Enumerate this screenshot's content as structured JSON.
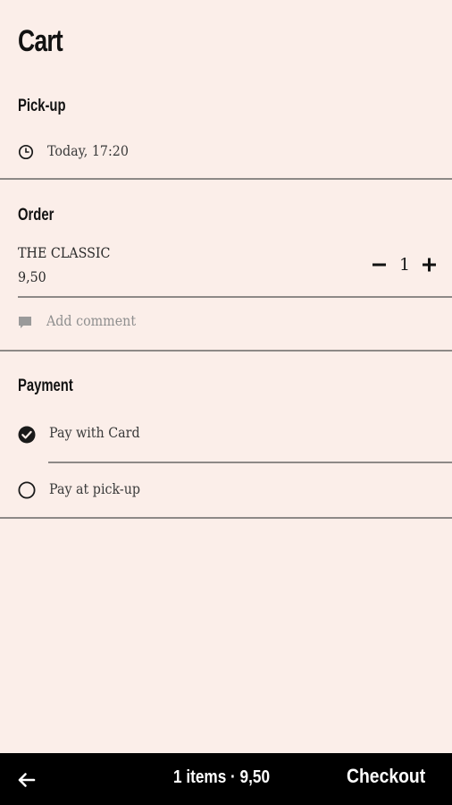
{
  "header": {
    "title": "Cart"
  },
  "pickup": {
    "heading": "Pick-up",
    "time": "Today, 17:20"
  },
  "order": {
    "heading": "Order",
    "items": [
      {
        "name": "THE CLASSIC",
        "price": "9,50",
        "quantity": "1"
      }
    ],
    "comment_placeholder": "Add comment"
  },
  "payment": {
    "heading": "Payment",
    "options": [
      {
        "label": "Pay with Card",
        "selected": true
      },
      {
        "label": "Pay at pick-up",
        "selected": false
      }
    ]
  },
  "footer": {
    "summary": "1 items · 9,50",
    "checkout_label": "Checkout"
  },
  "colors": {
    "background": "#fbeee9",
    "divider": "#8d8987",
    "bottom_bar": "#000000",
    "text": "#1a1a1a",
    "muted_text": "#3a3a3a"
  },
  "icons": {
    "pickup": "clock-icon",
    "comment": "comment-icon",
    "selected": "check-circle-icon",
    "unselected": "radio-empty-icon",
    "back": "arrow-left-icon",
    "decrement": "minus-icon",
    "increment": "plus-icon"
  }
}
